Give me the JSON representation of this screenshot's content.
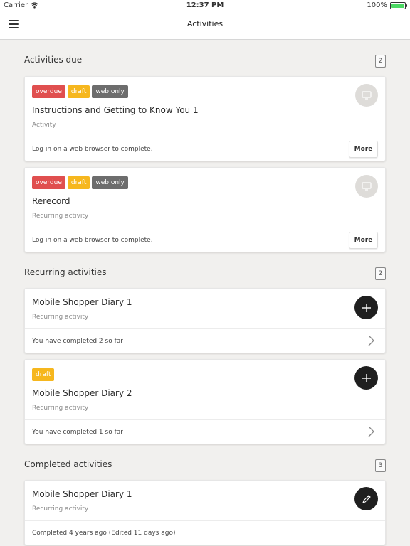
{
  "status_bar": {
    "carrier": "Carrier",
    "time": "12:37 PM",
    "battery": "100%",
    "battery_level": 1.0
  },
  "navbar": {
    "title": "Activities"
  },
  "colors": {
    "overdue": "#e04f4f",
    "draft": "#f6b71e",
    "web_only": "#6d6d6d",
    "fab": "#1f1f1f"
  },
  "sections": {
    "due": {
      "title": "Activities due",
      "count": "2",
      "cards": [
        {
          "tags": [
            "overdue",
            "draft",
            "web only"
          ],
          "title": "Instructions and Getting to Know You 1",
          "subtitle": "Activity",
          "footer": "Log in on a web browser to complete.",
          "button": "More",
          "icon": "monitor-icon"
        },
        {
          "tags": [
            "overdue",
            "draft",
            "web only"
          ],
          "title": "Rerecord",
          "subtitle": "Recurring activity",
          "footer": "Log in on a web browser to complete.",
          "button": "More",
          "icon": "monitor-icon"
        }
      ]
    },
    "recurring": {
      "title": "Recurring activities",
      "count": "2",
      "cards": [
        {
          "title": "Mobile Shopper Diary 1",
          "subtitle": "Recurring activity",
          "footer": "You have completed 2 so far",
          "icon": "plus-icon"
        },
        {
          "tags": [
            "draft"
          ],
          "title": "Mobile Shopper Diary 2",
          "subtitle": "Recurring activity",
          "footer": "You have completed 1 so far",
          "icon": "plus-icon"
        }
      ]
    },
    "completed": {
      "title": "Completed activities",
      "count": "3",
      "cards": [
        {
          "title": "Mobile Shopper Diary 1",
          "subtitle": "Recurring activity",
          "footer": "Completed 4 years ago (Edited 11 days ago)",
          "icon": "pencil-icon"
        }
      ]
    }
  }
}
